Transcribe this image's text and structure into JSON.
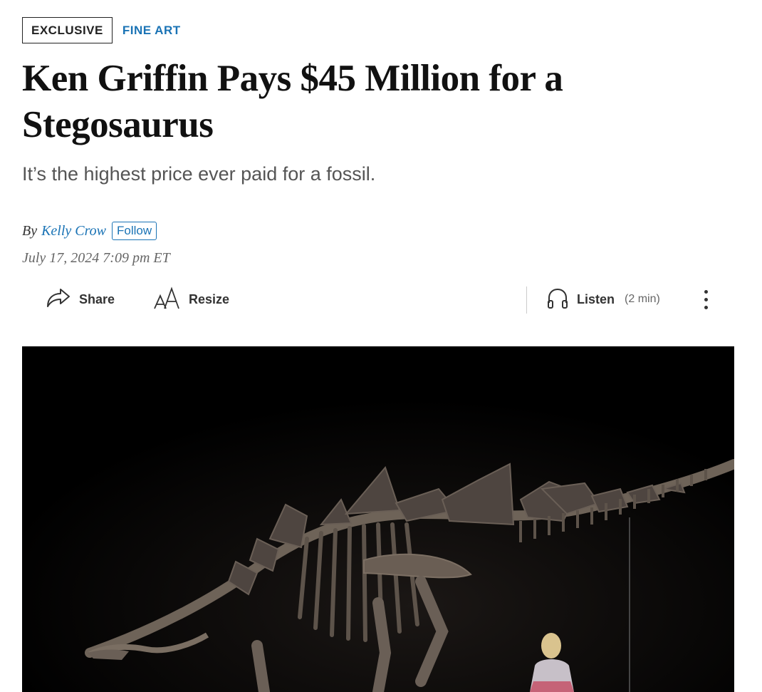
{
  "article": {
    "flag_label": "EXCLUSIVE",
    "section_label": "FINE ART",
    "headline": "Ken Griffin Pays $45 Million for a Stegosaurus",
    "dek": "It’s the highest price ever paid for a fossil.",
    "byline_prefix": "By",
    "author": "Kelly Crow",
    "follow_label": "Follow",
    "timestamp": "July 17, 2024 7:09 pm ET"
  },
  "toolbar": {
    "share_label": "Share",
    "resize_label": "Resize",
    "listen_label": "Listen",
    "listen_duration": "(2 min)",
    "icons": {
      "share": "share-arrow-icon",
      "resize": "text-resize-icon",
      "listen": "headphones-icon",
      "more": "more-vertical-icon"
    }
  },
  "colors": {
    "accent_link": "#1a73b5",
    "headline_text": "#111111",
    "dek_text": "#555555",
    "image_background": "#000000"
  }
}
